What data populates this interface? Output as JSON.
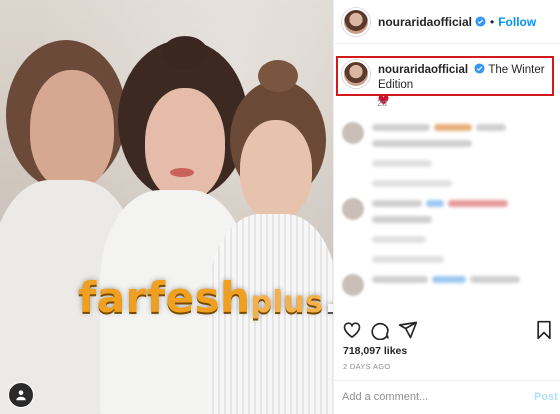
{
  "post": {
    "username": "nouraridaofficial",
    "follow_label": "Follow",
    "separator": "•"
  },
  "caption": {
    "username": "nouraridaofficial",
    "text": "The Winter Edition",
    "age": "2d"
  },
  "watermark": {
    "main": "farfesh",
    "plus": "plus",
    "dotcom": ".com"
  },
  "stats": {
    "likes": "718,097 likes",
    "date": "2 DAYS AGO"
  },
  "comment_bar": {
    "placeholder": "Add a comment...",
    "post_label": "Post"
  },
  "colors": {
    "link": "#0095f6",
    "highlight": "#d31a1a",
    "heart": "#c8102e",
    "watermark": "#f0a020"
  },
  "icons": [
    "verified-badge-icon",
    "heart-icon",
    "comment-icon",
    "share-icon",
    "bookmark-icon",
    "user-tag-icon"
  ]
}
